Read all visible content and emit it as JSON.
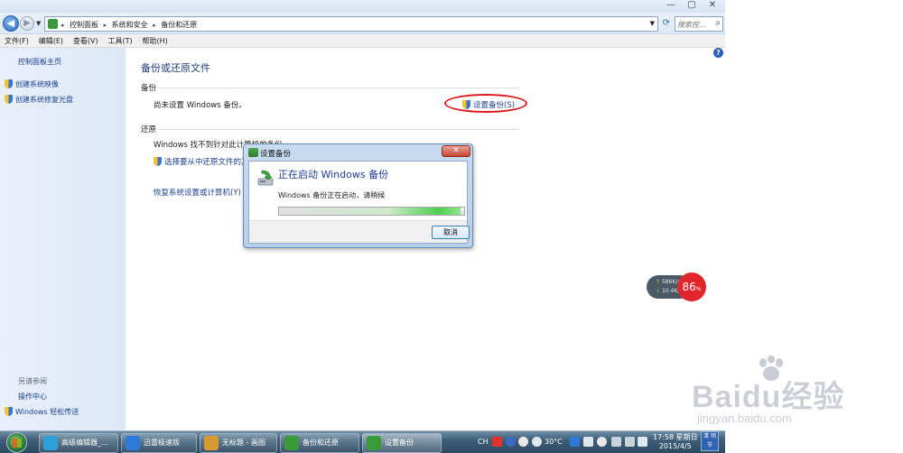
{
  "window": {
    "minimize": "—",
    "maximize": "▢",
    "close": "✕"
  },
  "nav": {
    "back_glyph": "◀",
    "forward_glyph": "▶",
    "breadcrumbs": [
      "控制面板",
      "系统和安全",
      "备份和还原"
    ],
    "search_placeholder": "搜索控...",
    "search_glyph": "⌕",
    "refresh_glyph": "⟳"
  },
  "menu": [
    "文件(F)",
    "编辑(E)",
    "查看(V)",
    "工具(T)",
    "帮助(H)"
  ],
  "left_pane": {
    "home": "控制面板主页",
    "links": [
      "创建系统映像",
      "创建系统修复光盘"
    ],
    "see_also_title": "另请参阅",
    "see_also": [
      "操作中心",
      "Windows 轻松传送"
    ]
  },
  "main": {
    "title": "备份或还原文件",
    "backup_section": "备份",
    "backup_status": "尚未设置 Windows 备份。",
    "setup_backup_link": "设置备份(S)",
    "restore_section": "还原",
    "restore_status": "Windows 找不到针对此计算机的备份。",
    "restore_select_link": "选择要从中还原文件的其他备份",
    "recover_link": "恢复系统设置或计算机(Y)",
    "help_glyph": "?"
  },
  "dialog": {
    "title": "设置备份",
    "close_glyph": "✕",
    "heading": "正在启动 Windows 备份",
    "message": "Windows 备份正在启动，请稍候",
    "progress": 0.98,
    "cancel": "取消"
  },
  "net_widget": {
    "upload": "586",
    "upload_unit": "K/s",
    "download": "10.4",
    "download_unit": "K/s",
    "percent": "86",
    "percent_unit": "%"
  },
  "watermark": {
    "logo": "Baidu经验",
    "url": "jingyan.baidu.com"
  },
  "taskbar": {
    "items": [
      {
        "label": "高级编辑器_...",
        "icon": "ie-icon",
        "color": "#2f9fd8"
      },
      {
        "label": "迅雷极速版",
        "icon": "xunlei-icon",
        "color": "#2f7ad8"
      },
      {
        "label": "无标题 - 画图",
        "icon": "paint-icon",
        "color": "#d89a2f"
      },
      {
        "label": "备份和还原",
        "icon": "backup-icon",
        "color": "#3a9a3a"
      },
      {
        "label": "设置备份",
        "icon": "backup-icon",
        "color": "#3a9a3a"
      }
    ],
    "tray": {
      "ime": "CH",
      "weather": "30°C",
      "time": "17:58 星期日",
      "date": "2015/4/5",
      "show_desktop": "清 明节"
    }
  },
  "colors": {
    "link": "#1b3f8f",
    "heading": "#1e3b79",
    "highlight_ellipse": "#d9161c",
    "progress": "#4fce4f"
  }
}
